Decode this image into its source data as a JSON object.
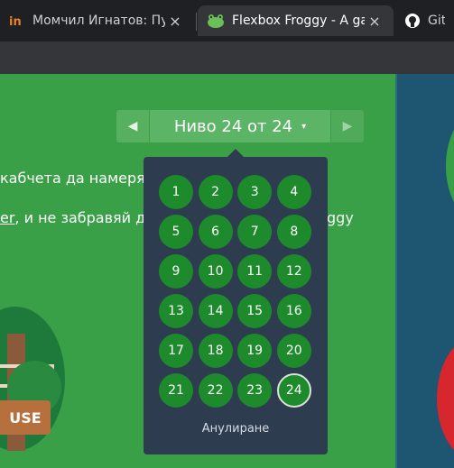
{
  "browser": {
    "tabs": [
      {
        "title": "Момчил Игнатов: Пуб",
        "favicon": "in-icon",
        "active": false
      },
      {
        "title": "Flexbox Froggy - A gam",
        "favicon": "frog-icon",
        "active": true
      },
      {
        "title": "GitH",
        "favicon": "github-icon",
        "active": false
      }
    ],
    "close_glyph": "×"
  },
  "page": {
    "line1": "кабчета да намерят",
    "line2_link": "er",
    "line2_rest": ", и не забравяй д",
    "line2_tail": "ggy",
    "sign_text": "USE"
  },
  "level_nav": {
    "label": "Ниво 24 от 24",
    "caret": "▾",
    "prev_glyph": "◀",
    "next_glyph": "▶"
  },
  "level_menu": {
    "levels": [
      "1",
      "2",
      "3",
      "4",
      "5",
      "6",
      "7",
      "8",
      "9",
      "10",
      "11",
      "12",
      "13",
      "14",
      "15",
      "16",
      "17",
      "18",
      "19",
      "20",
      "21",
      "22",
      "23",
      "24"
    ],
    "current": "24",
    "cancel_label": "Анулиране"
  },
  "colors": {
    "page_green": "#3aa047",
    "level_green": "#1d8a2c",
    "dropdown_bg": "#2e3c4f",
    "right_pane": "#1e5570"
  }
}
